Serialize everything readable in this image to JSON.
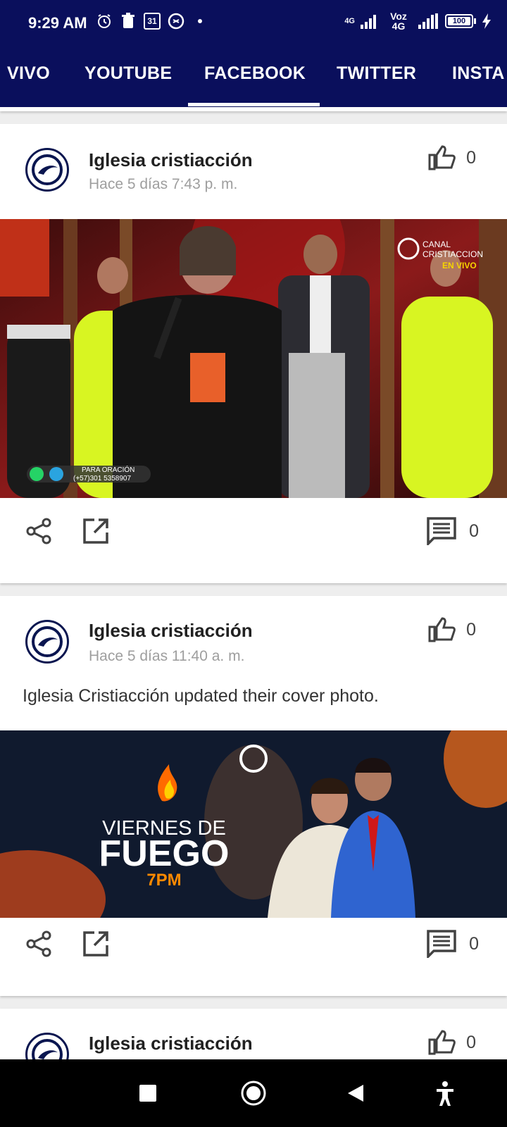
{
  "status_bar": {
    "time": "9:29 AM",
    "icons": [
      "alarm-icon",
      "trash-icon",
      "calendar-icon",
      "vpn-icon",
      "dot-icon"
    ],
    "calendar_day": "31",
    "network_label_1": "4G",
    "network_label_2": "Voz 4G",
    "battery_level": "100"
  },
  "tabs": [
    {
      "label": "VIVO"
    },
    {
      "label": "YOUTUBE"
    },
    {
      "label": "FACEBOOK"
    },
    {
      "label": "TWITTER"
    },
    {
      "label": "INSTA"
    }
  ],
  "selected_tab": "FACEBOOK",
  "posts": [
    {
      "author": "Iglesia cristiacción",
      "timestamp": "Hace 5 días 7:43 p. m.",
      "likes": "0",
      "comments": "0",
      "image": {
        "channel_line1": "CANAL",
        "channel_line2": "CRISTIACCION",
        "live_label": "EN VIVO",
        "prayer_label": "PARA ORACIÓN",
        "prayer_phone": "(+57)301 5358907"
      }
    },
    {
      "author": "Iglesia cristiacción",
      "timestamp": "Hace 5 días 11:40 a. m.",
      "text": "Iglesia Cristiacción updated their cover photo.",
      "likes": "0",
      "comments": "0",
      "image": {
        "line1": "VIERNES DE",
        "line2": "FUEGO",
        "line3": "7PM"
      }
    },
    {
      "author": "Iglesia cristiacción",
      "likes": "0"
    }
  ],
  "colors": {
    "primary": "#0a0f5c",
    "neon_dress": "#d8f522",
    "fire": "#ff6a00",
    "banner_bg": "#101a2e"
  },
  "nav_bar": {
    "icons": [
      "recents-icon",
      "home-icon",
      "back-icon",
      "accessibility-icon"
    ]
  }
}
